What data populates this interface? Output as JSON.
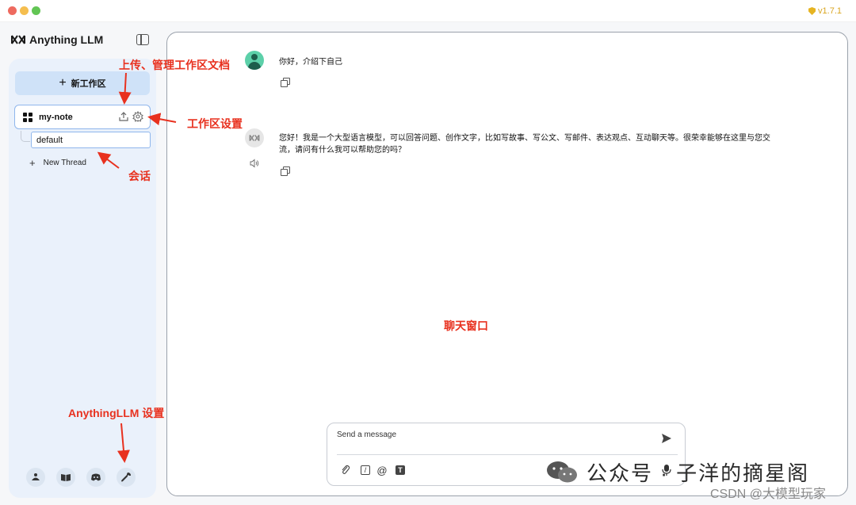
{
  "window": {
    "version": "v1.7.1"
  },
  "brand": {
    "name": "Anything LLM"
  },
  "sidebar": {
    "new_workspace_label": "新工作区",
    "workspace": {
      "name": "my-note"
    },
    "thread": {
      "name": "default"
    },
    "new_thread_label": "New Thread",
    "footer_icons": [
      "community-hub-icon",
      "docs-book-icon",
      "discord-icon",
      "wrench-settings-icon"
    ]
  },
  "chat": {
    "messages": [
      {
        "role": "user",
        "text": "你好，介绍下自己"
      },
      {
        "role": "assistant",
        "text": "您好！我是一个大型语言模型，可以回答问题、创作文字，比如写故事、写公文、写邮件、表达观点、互动聊天等。很荣幸能够在这里与您交流，请问有什么我可以帮助您的吗？"
      }
    ],
    "input": {
      "placeholder": "Send a message"
    }
  },
  "annotations": {
    "upload": "上传、管理工作区文档",
    "workspace_settings": "工作区设置",
    "session": "会话",
    "chat_window": "聊天窗口",
    "app_settings": "AnythingLLM 设置"
  },
  "watermark": {
    "wechat": "公众号 · 子洋的摘星阁",
    "csdn": "CSDN @大模型玩家"
  },
  "colors": {
    "accent_blue": "#8fb6ec",
    "annotation_red": "#e8311f",
    "sidebar_bg": "#eaf1fb",
    "version_gold": "#d9a520"
  }
}
